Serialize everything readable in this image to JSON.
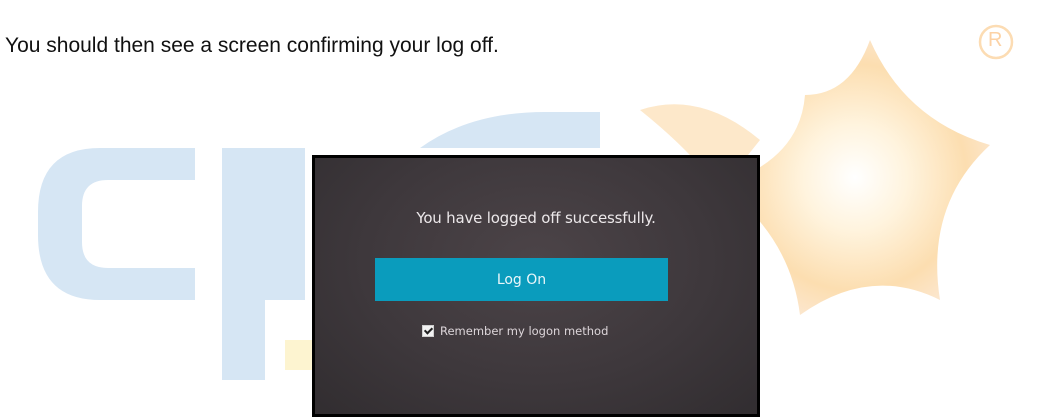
{
  "document": {
    "intro": "You should then see a screen confirming your log off."
  },
  "logoff_screen": {
    "message": "You have logged off successfully.",
    "logon_button_label": "Log On",
    "remember_label": "Remember my logon method",
    "remember_checked": true,
    "button_color": "#0a9cbd"
  },
  "watermark": {
    "brand_color": "#d6e6f4",
    "star_color": "#fbd9a6",
    "registered_mark": "R"
  }
}
